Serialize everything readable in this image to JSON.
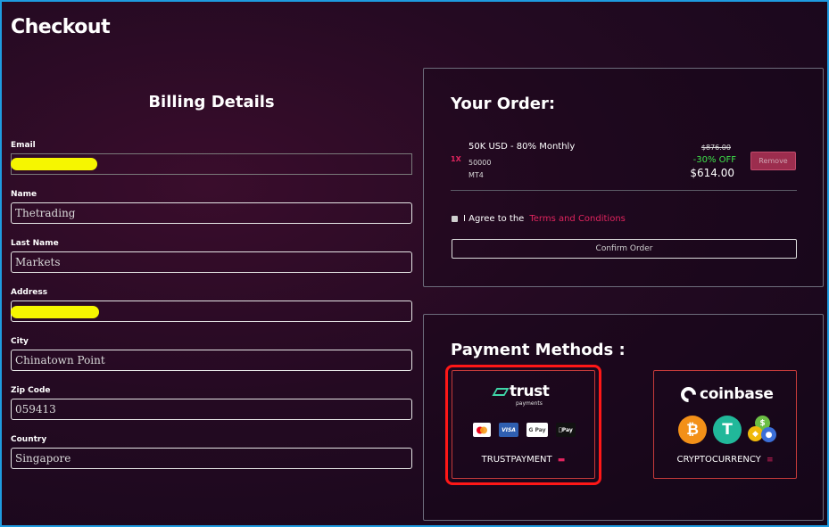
{
  "page": {
    "title": "Checkout"
  },
  "billing": {
    "title": "Billing Details",
    "fields": {
      "email": {
        "label": "Email",
        "value": ""
      },
      "name": {
        "label": "Name",
        "value": "Thetrading"
      },
      "last_name": {
        "label": "Last Name",
        "value": "Markets"
      },
      "address": {
        "label": "Address",
        "value": ""
      },
      "city": {
        "label": "City",
        "value": "Chinatown Point"
      },
      "zip": {
        "label": "Zip Code",
        "value": "059413"
      },
      "country": {
        "label": "Country",
        "value": "Singapore"
      }
    }
  },
  "order": {
    "title": "Your Order:",
    "item": {
      "qty": "1X",
      "name": "50K USD - 80% Monthly",
      "size": "50000",
      "platform": "MT4",
      "price_old": "$876.00",
      "discount": "-30% OFF",
      "price_new": "$614.00",
      "remove_label": "Remove"
    },
    "agree_text": "I Agree to the",
    "terms_link": "Terms and Conditions",
    "confirm_label": "Confirm Order"
  },
  "payment": {
    "title": "Payment Methods :",
    "trust": {
      "brand": "trust",
      "brand_sub": "payments",
      "cards": {
        "mastercard": "",
        "visa": "VISA",
        "gpay": "G Pay",
        "applepay": "Pay"
      },
      "label": "TRUSTPAYMENT"
    },
    "coinbase": {
      "brand": "coinbase",
      "coins": {
        "btc": "₿",
        "usdt": "T"
      },
      "label": "CRYPTOCURRENCY"
    }
  },
  "colors": {
    "accent": "#e0245e",
    "highlight": "#ff1717",
    "discount": "#3ee24a",
    "redaction": "#f6f600"
  }
}
